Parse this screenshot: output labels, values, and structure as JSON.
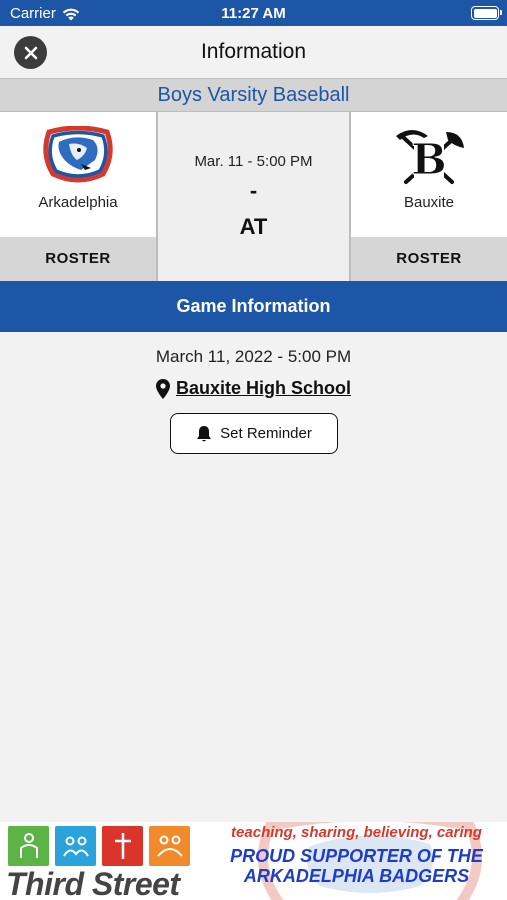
{
  "status_bar": {
    "carrier": "Carrier",
    "time": "11:27 AM"
  },
  "nav": {
    "title": "Information"
  },
  "event": {
    "sport": "Boys Varsity Baseball"
  },
  "home_team": {
    "name": "Arkadelphia",
    "roster_label": "ROSTER"
  },
  "away_team": {
    "name": "Bauxite",
    "roster_label": "ROSTER"
  },
  "matchup": {
    "date": "Mar. 11 - 5:00 PM",
    "score": "-",
    "versus": "AT"
  },
  "game_info": {
    "header": "Game Information",
    "date": "March 11, 2022 - 5:00 PM",
    "location": "Bauxite High School",
    "reminder_label": "Set Reminder"
  },
  "ad": {
    "brand": "Third Street",
    "tagline": "teaching, sharing, believing, caring",
    "support_line1": "PROUD SUPPORTER OF THE",
    "support_line2": "ARKADELPHIA BADGERS"
  },
  "colors": {
    "primary": "#1d56a6",
    "banner_gray": "#d4d4d4",
    "tagline_red": "#d23a2f",
    "support_blue": "#1d3cc9"
  }
}
